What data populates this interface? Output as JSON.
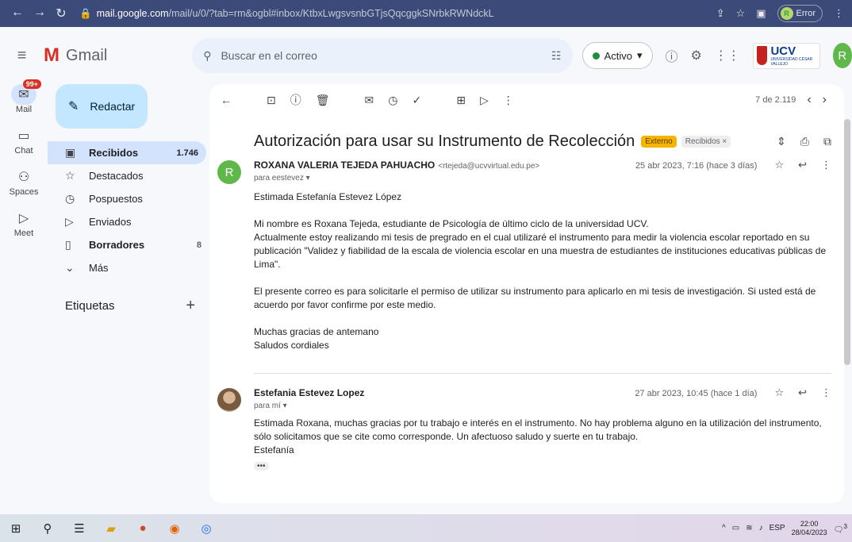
{
  "browser": {
    "url_host": "mail.google.com",
    "url_path": "/mail/u/0/?tab=rm&ogbl#inbox/KtbxLwgsvsnbGTjsQqcggkSNrbkRWNdckL",
    "profile_initial": "R",
    "profile_status": "Error"
  },
  "header": {
    "app_name": "Gmail",
    "search_placeholder": "Buscar en el correo",
    "status_label": "Activo",
    "org_logo_text": "UCV",
    "org_logo_sub": "UNIVERSIDAD CÉSAR VALLEJO",
    "account_initial": "R"
  },
  "rail": {
    "items": [
      {
        "label": "Mail",
        "badge": "99+"
      },
      {
        "label": "Chat"
      },
      {
        "label": "Spaces"
      },
      {
        "label": "Meet"
      }
    ]
  },
  "sidebar": {
    "compose_label": "Redactar",
    "items": [
      {
        "label": "Recibidos",
        "count": "1.746"
      },
      {
        "label": "Destacados",
        "count": ""
      },
      {
        "label": "Pospuestos",
        "count": ""
      },
      {
        "label": "Enviados",
        "count": ""
      },
      {
        "label": "Borradores",
        "count": "8"
      },
      {
        "label": "Más",
        "count": ""
      }
    ],
    "labels_heading": "Etiquetas"
  },
  "toolbar": {
    "pager_text": "7 de 2.119"
  },
  "thread": {
    "subject": "Autorización para usar su Instrumento de Recolección",
    "chip_external": "Externo",
    "chip_inbox": "Recibidos ×",
    "messages": [
      {
        "avatar_initial": "R",
        "sender_name": "ROXANA VALERIA TEJEDA PAHUACHO",
        "sender_email": "<rtejeda@ucvvirtual.edu.pe>",
        "date": "25 abr 2023, 7:16 (hace 3 días)",
        "to": "para eestevez ▾",
        "paragraphs": [
          "Estimada Estefanía Estevez López",
          "Mi nombre es Roxana Tejeda, estudiante de Psicología de último ciclo de la universidad UCV.",
          "Actualmente estoy realizando mi tesis de pregrado en el cual utilizaré el instrumento para medir la violencia escolar reportado en su publicación \"Validez y fiabilidad de la escala de violencia escolar en una muestra de estudiantes de instituciones educativas públicas de Lima\".",
          "El presente correo es para solicitarle el permiso de utilizar su instrumento para aplicarlo en mi tesis de investigación. Si usted está de acuerdo por favor confirme por este medio.",
          "Muchas gracias de antemano",
          "Saludos cordiales"
        ]
      },
      {
        "sender_name": "Estefania Estevez Lopez",
        "date": "27 abr 2023, 10:45 (hace 1 día)",
        "to": "para mí ▾",
        "paragraphs": [
          "Estimada Roxana, muchas gracias por tu trabajo e interés en el instrumento. No hay problema alguno en la utilización del instrumento, sólo solicitamos que se cite como corresponde. Un afectuoso saludo y suerte en tu trabajo.",
          "Estefanía"
        ],
        "more": "•••"
      }
    ]
  },
  "taskbar": {
    "language": "ESP",
    "time": "22:00",
    "date": "28/04/2023",
    "notifications": "3"
  }
}
